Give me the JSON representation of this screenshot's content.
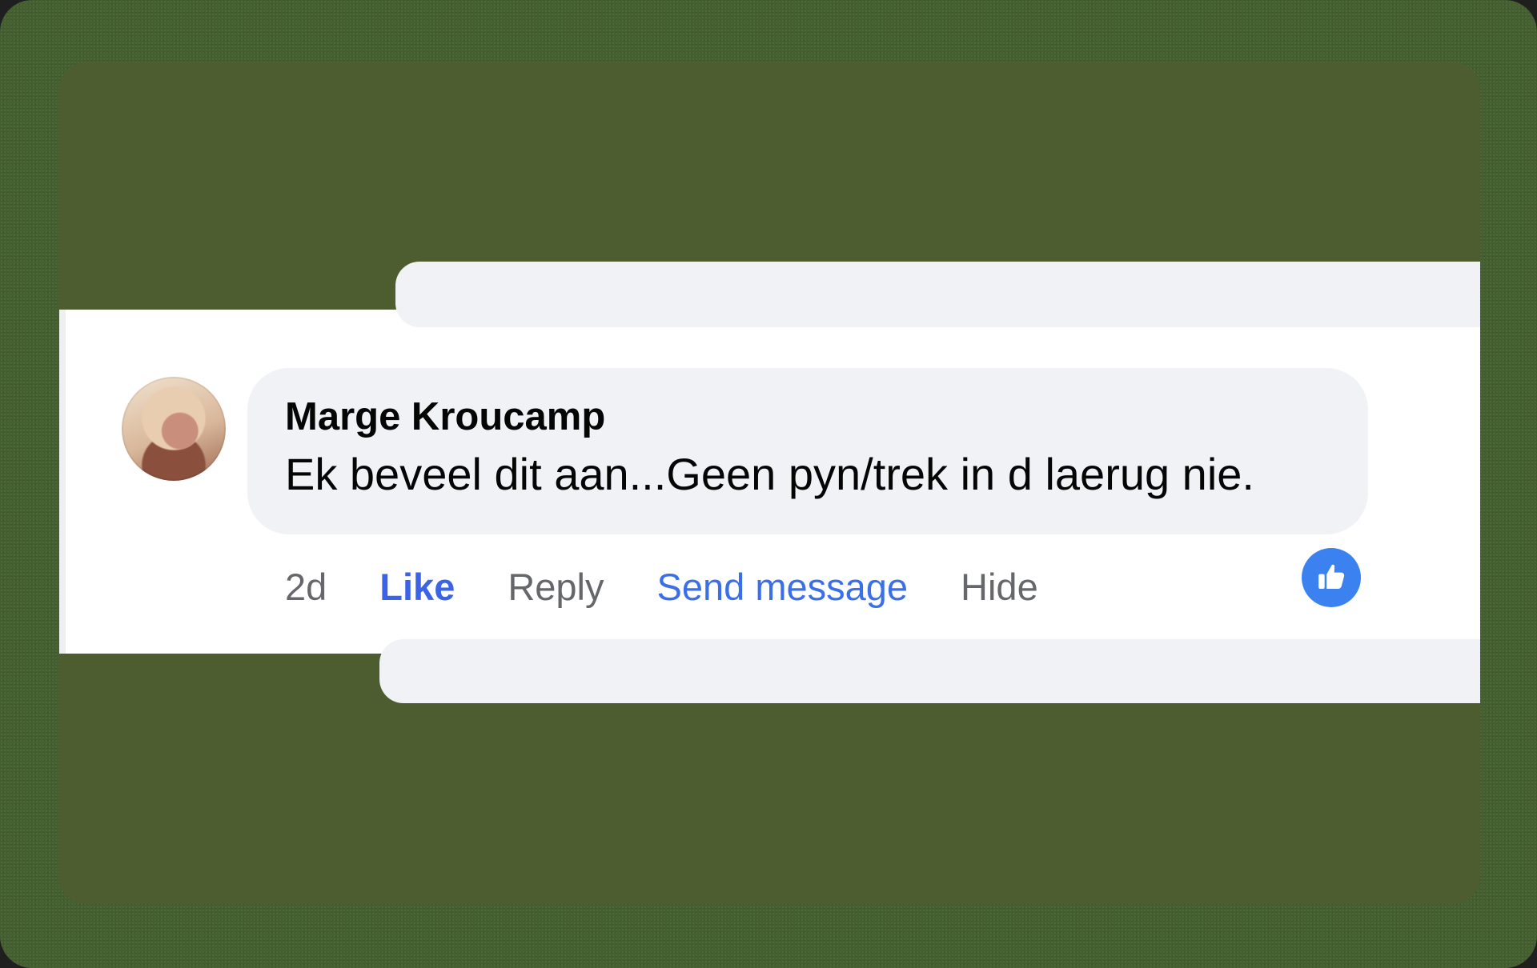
{
  "comment": {
    "author": "Marge Kroucamp",
    "text": "Ek beveel dit aan...Geen pyn/trek in d laerug nie.",
    "timestamp": "2d",
    "actions": {
      "like": "Like",
      "reply": "Reply",
      "send_message": "Send message",
      "hide": "Hide"
    },
    "reaction_icon": "thumbs-up-icon"
  },
  "colors": {
    "background": "#4d5d2f",
    "bubble": "#f0f2f5",
    "like_active": "#3b63e6",
    "link": "#3b6fe8",
    "muted": "#65676b",
    "reaction": "#3b82f0"
  }
}
